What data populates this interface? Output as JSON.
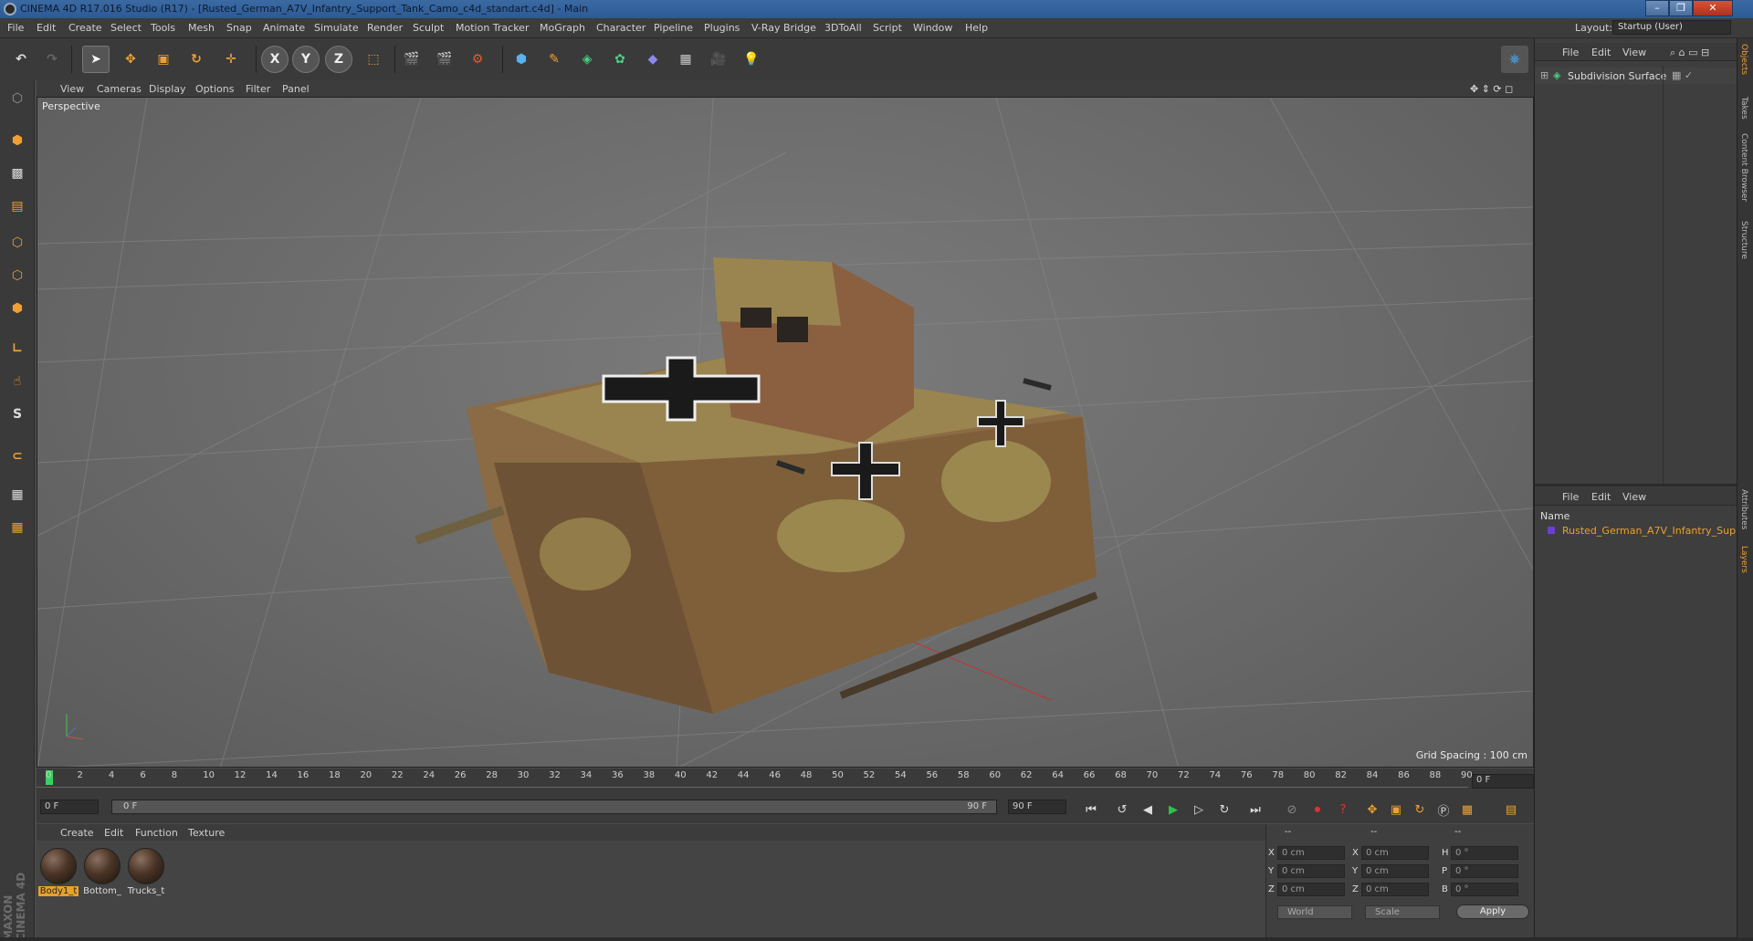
{
  "window": {
    "title": "CINEMA 4D R17.016 Studio (R17) - [Rusted_German_A7V_Infantry_Support_Tank_Camo_c4d_standart.c4d] - Main",
    "controls": [
      "–",
      "❐",
      "✕"
    ]
  },
  "menubar": {
    "items": [
      "File",
      "Edit",
      "Create",
      "Select",
      "Tools",
      "Mesh",
      "Snap",
      "Animate",
      "Simulate",
      "Render",
      "Sculpt",
      "Motion Tracker",
      "MoGraph",
      "Character",
      "Pipeline",
      "Plugins",
      "V-Ray Bridge",
      "3DToAll",
      "Script",
      "Window",
      "Help"
    ],
    "layout_label": "Layout:",
    "layout_value": "Startup (User)"
  },
  "toolbar": {
    "axis_x": "X",
    "axis_y": "Y",
    "axis_z": "Z"
  },
  "viewport": {
    "menu": [
      "View",
      "Cameras",
      "Display",
      "Options",
      "Filter",
      "Panel"
    ],
    "label": "Perspective",
    "grid_spacing": "Grid Spacing : 100 cm"
  },
  "timeline": {
    "ticks": [
      "0",
      "2",
      "4",
      "6",
      "8",
      "10",
      "12",
      "14",
      "16",
      "18",
      "20",
      "22",
      "24",
      "26",
      "28",
      "30",
      "32",
      "34",
      "36",
      "38",
      "40",
      "42",
      "44",
      "46",
      "48",
      "50",
      "52",
      "54",
      "56",
      "58",
      "60",
      "62",
      "64",
      "66",
      "68",
      "70",
      "72",
      "74",
      "76",
      "78",
      "80",
      "82",
      "84",
      "86",
      "88",
      "90"
    ],
    "current_frame": "0 F",
    "start_field": "0 F",
    "range_start": "0 F",
    "range_end": "90 F",
    "end_field": "90 F"
  },
  "materials": {
    "menu": [
      "Create",
      "Edit",
      "Function",
      "Texture"
    ],
    "items": [
      {
        "name": "Body1_t"
      },
      {
        "name": "Bottom_"
      },
      {
        "name": "Trucks_t"
      }
    ]
  },
  "coordinates": {
    "header": [
      "--",
      "--",
      "--"
    ],
    "rows": [
      {
        "l1": "X",
        "v1": "0 cm",
        "l2": "X",
        "v2": "0 cm",
        "l3": "H",
        "v3": "0 °"
      },
      {
        "l1": "Y",
        "v1": "0 cm",
        "l2": "Y",
        "v2": "0 cm",
        "l3": "P",
        "v3": "0 °"
      },
      {
        "l1": "Z",
        "v1": "0 cm",
        "l2": "Z",
        "v2": "0 cm",
        "l3": "B",
        "v3": "0 °"
      }
    ],
    "space_dropdown": "World",
    "mode_dropdown": "Scale",
    "apply_label": "Apply"
  },
  "object_manager": {
    "menu": [
      "File",
      "Edit",
      "View"
    ],
    "objects": [
      {
        "name": "Subdivision Surface"
      }
    ]
  },
  "layer_manager": {
    "menu": [
      "File",
      "Edit",
      "View"
    ],
    "column_name": "Name",
    "layers": [
      {
        "name": "Rusted_German_A7V_Infantry_Sup",
        "color": "#6a3fd0"
      }
    ]
  },
  "right_tabs": [
    "Objects",
    "Takes",
    "Content Browser",
    "Structure",
    "Attributes",
    "Layers"
  ],
  "branding": "MAXON CINEMA 4D",
  "colors": {
    "accent": "#e8a22a",
    "play": "#2fc24a",
    "layer_text": "#e8a22a"
  }
}
